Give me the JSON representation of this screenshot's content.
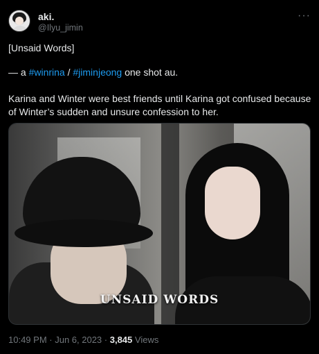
{
  "author": {
    "name": "aki.",
    "handle": "@Ilyu_jimin"
  },
  "header": {
    "more_icon": "more-horizontal-icon"
  },
  "tweet": {
    "title": "[Unsaid Words]",
    "prefix": "— a ",
    "tag1": "#winrina",
    "sep": " / ",
    "tag2": "#jiminjeong",
    "suffix": " one shot au.",
    "body": "Karina and Winter were best friends until Karina got confused because of Winter’s sudden and unsure confession to her."
  },
  "media": {
    "caption": "UNSAID WORDS"
  },
  "meta": {
    "time": "10:49 PM",
    "dot1": " · ",
    "date": "Jun 6, 2023",
    "dot2": " · ",
    "views": "3,845",
    "views_label": " Views"
  },
  "colors": {
    "link": "#1d9bf0",
    "secondary": "#71767b",
    "text": "#e7e9ea",
    "background": "#000000"
  }
}
